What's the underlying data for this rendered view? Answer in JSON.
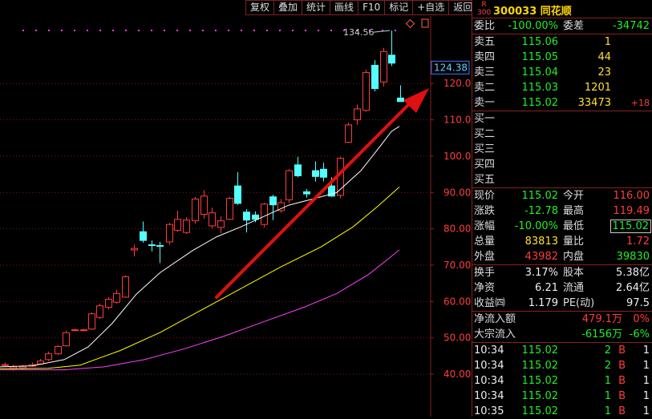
{
  "toolbar": {
    "items": [
      "复权",
      "叠加",
      "统计",
      "画线",
      "F10",
      "标记",
      "+自选",
      "返回"
    ]
  },
  "chart": {
    "y_ticks": [
      "120.0",
      "110.0",
      "100.0",
      "90.00",
      "80.00",
      "70.00",
      "60.00",
      "50.00",
      "40.00"
    ],
    "current_price_label": "124.38",
    "high_annotation": "134.56",
    "colors": {
      "up": "#ff3c3c",
      "down": "#54ffff",
      "ma5": "#ffffff",
      "ma10": "#ffff00",
      "ma20": "#ff40ff",
      "arrow": "#e01010",
      "grid": "#7a1a1a"
    }
  },
  "stock": {
    "badge_top": "R",
    "badge_bottom": "300",
    "code_name": "300033 同花顺"
  },
  "commission": {
    "ratio_label": "委比",
    "ratio_value": "-100.00%",
    "diff_label": "委差",
    "diff_value": "-34742"
  },
  "asks": [
    {
      "label": "卖五",
      "price": "115.06",
      "vol": "1",
      "chg": ""
    },
    {
      "label": "卖四",
      "price": "115.05",
      "vol": "44",
      "chg": ""
    },
    {
      "label": "卖三",
      "price": "115.04",
      "vol": "23",
      "chg": ""
    },
    {
      "label": "卖二",
      "price": "115.03",
      "vol": "1201",
      "chg": ""
    },
    {
      "label": "卖一",
      "price": "115.02",
      "vol": "33473",
      "chg": "+18"
    }
  ],
  "bids": [
    {
      "label": "买一"
    },
    {
      "label": "买二"
    },
    {
      "label": "买三"
    },
    {
      "label": "买四"
    },
    {
      "label": "买五"
    }
  ],
  "quote": [
    {
      "l1": "现价",
      "v1": "115.02",
      "l2": "今开",
      "v2": "116.00"
    },
    {
      "l1": "涨跌",
      "v1": "-12.78",
      "l2": "最高",
      "v2": "119.49"
    },
    {
      "l1": "涨幅",
      "v1": "-10.00%",
      "l2": "最低",
      "v2": "115.02"
    },
    {
      "l1": "总量",
      "v1": "83813",
      "l2": "量比",
      "v2": "1.72"
    },
    {
      "l1": "外盘",
      "v1": "43982",
      "l2": "内盘",
      "v2": "39830"
    }
  ],
  "finance": [
    {
      "l1": "换手",
      "v1": "3.17%",
      "l2": "股本",
      "v2": "5.38亿"
    },
    {
      "l1": "净资",
      "v1": "6.21",
      "l2": "流通",
      "v2": "2.64亿"
    },
    {
      "l1": "收益㈣",
      "v1": "1.179",
      "l2": "PE(动)",
      "v2": "97.5"
    }
  ],
  "flow": [
    {
      "label": "净流入额",
      "value": "479.1万",
      "pct": "0%"
    },
    {
      "label": "大宗流入",
      "value": "-6156万",
      "pct": "-6%"
    }
  ],
  "ticks": [
    {
      "time": "10:34",
      "price": "115.02",
      "vol": "2",
      "side": "B",
      "n": "1"
    },
    {
      "time": "10:34",
      "price": "115.02",
      "vol": "2",
      "side": "B",
      "n": "1"
    },
    {
      "time": "10:34",
      "price": "115.02",
      "vol": "1",
      "side": "B",
      "n": "1"
    },
    {
      "time": "10:34",
      "price": "115.02",
      "vol": "1",
      "side": "B",
      "n": "1"
    },
    {
      "time": "10:35",
      "price": "115.02",
      "vol": "1",
      "side": "B",
      "n": "1"
    }
  ]
}
